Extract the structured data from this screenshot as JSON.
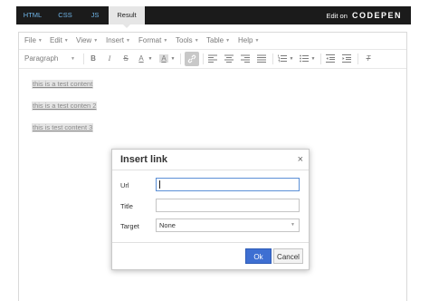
{
  "codepen": {
    "tabs": [
      {
        "label": "HTML",
        "active": false
      },
      {
        "label": "CSS",
        "active": false
      },
      {
        "label": "JS",
        "active": false
      },
      {
        "label": "Result",
        "active": true
      }
    ],
    "edit_on": "Edit on",
    "logo": "CODEPEN"
  },
  "menubar": [
    "File",
    "Edit",
    "View",
    "Insert",
    "Format",
    "Tools",
    "Table",
    "Help"
  ],
  "toolbar": {
    "format_select": "Paragraph",
    "buttons": [
      "bold-icon",
      "italic-icon",
      "strikethrough-icon",
      "text-color-icon",
      "background-color-icon",
      "link-icon",
      "align-left-icon",
      "align-center-icon",
      "align-right-icon",
      "align-justify-icon",
      "numbered-list-icon",
      "bullet-list-icon",
      "outdent-icon",
      "indent-icon",
      "clear-formatting-icon"
    ],
    "glyphs": {
      "bold": "B",
      "italic": "I",
      "strike": "S",
      "text_color": "A",
      "bg_color": "A",
      "clear": "T"
    }
  },
  "content": {
    "paragraphs": [
      "this is a test content",
      "this is a test conten 2",
      "this is test content 3"
    ]
  },
  "dialog": {
    "title": "Insert link",
    "close": "×",
    "fields": {
      "url_label": "Url",
      "url_value": "",
      "title_label": "Title",
      "title_value": "",
      "target_label": "Target",
      "target_value": "None"
    },
    "ok": "Ok",
    "cancel": "Cancel"
  },
  "colors": {
    "primary_button": "#3e6fd2",
    "codepen_bar": "#1b1b1b",
    "tab_link": "#6fb5e8"
  }
}
